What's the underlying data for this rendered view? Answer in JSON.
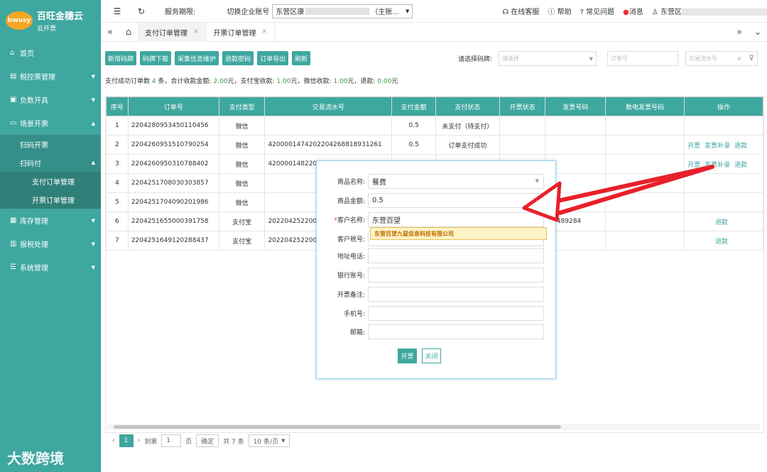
{
  "sidebar": {
    "logo_mark": "bwusy",
    "title": "百旺金穗云",
    "subtitle": "云开票",
    "items": [
      {
        "label": "首页",
        "icon": "home-icon"
      },
      {
        "label": "税控票管理",
        "icon": "ledger-icon"
      },
      {
        "label": "负数开具",
        "icon": "document-icon"
      },
      {
        "label": "场景开票",
        "icon": "card-icon"
      }
    ],
    "sub_items": [
      "扫码开票",
      "扫码付"
    ],
    "subsub_items": [
      "支付订单管理",
      "开票订单管理"
    ],
    "bottom_items": [
      {
        "label": "库存管理",
        "icon": "box-icon"
      },
      {
        "label": "报税处理",
        "icon": "chart-icon"
      },
      {
        "label": "系统管理",
        "icon": "settings-icon"
      }
    ],
    "watermark": "大数跨境"
  },
  "topbar": {
    "service_label": "服务期限:",
    "switch_label": "切换企业账号",
    "account_prefix": "东营区康",
    "account_suffix": "（主账...",
    "online": "在线客服",
    "help": "帮助",
    "faq": "常见问题",
    "messages": "消息",
    "user": "东营区"
  },
  "tabs": [
    {
      "label": "支付订单管理",
      "active": true
    },
    {
      "label": "开票订单管理",
      "active": false
    }
  ],
  "toolbar": {
    "buttons": [
      "新增码牌",
      "码牌下载",
      "采集信息维护",
      "退款密码",
      "订单导出",
      "刷新"
    ],
    "filter_label": "请选择码牌:",
    "select_placeholder": "请选择",
    "order_placeholder": "订单号",
    "serial_placeholder": "交易流水号"
  },
  "summary": {
    "p1": "支付成功订单数",
    "count": "4",
    "p2": "条，合计收款金额:",
    "total": "2.00",
    "p3": "元，支付宝收款:",
    "alipay": "1.00",
    "p4": "元，微信收款:",
    "wechat": "1.00",
    "p5": "元，退款:",
    "refund": "0.00",
    "p6": "元"
  },
  "table": {
    "headers": [
      "序号",
      "订单号",
      "支付类型",
      "交易流水号",
      "支付金额",
      "支付状态",
      "开票状态",
      "发票号码",
      "数电发票号码",
      "操作"
    ],
    "rows": [
      {
        "no": "1",
        "order": "2204280953450110456",
        "type": "微信",
        "serial": "",
        "amount": "0.5",
        "status": "未支付（待支付）",
        "invoice_status": "",
        "invoice_no": "",
        "digital_no": "",
        "ops": []
      },
      {
        "no": "2",
        "order": "2204260951510790254",
        "type": "微信",
        "serial": "4200001474202204268818931261",
        "amount": "0.5",
        "status": "订单支付成功",
        "invoice_status": "",
        "invoice_no": "",
        "digital_no": "",
        "ops": [
          "开票",
          "发票补录",
          "退款"
        ]
      },
      {
        "no": "3",
        "order": "2204260950310788402",
        "type": "微信",
        "serial": "4200001482202",
        "amount": "",
        "status": "",
        "invoice_status": "",
        "invoice_no": "",
        "digital_no": "",
        "ops": [
          "开票",
          "发票补录",
          "退款"
        ]
      },
      {
        "no": "4",
        "order": "2204251708030303857",
        "type": "微信",
        "serial": "",
        "amount": "",
        "status": "",
        "invoice_status": "",
        "invoice_no": "",
        "digital_no": "",
        "ops": []
      },
      {
        "no": "5",
        "order": "2204251704090201986",
        "type": "微信",
        "serial": "",
        "amount": "",
        "status": "",
        "invoice_status": "",
        "invoice_no": "",
        "digital_no": "",
        "ops": []
      },
      {
        "no": "6",
        "order": "2204251655000391758",
        "type": "支付宝",
        "serial": "2022042522003",
        "amount": "",
        "status": "",
        "invoice_status": "",
        "invoice_no": "83489284",
        "digital_no": "",
        "ops": [
          "退款"
        ]
      },
      {
        "no": "7",
        "order": "2204251649120288437",
        "type": "支付宝",
        "serial": "2022042522003",
        "amount": "",
        "status": "",
        "invoice_status": "",
        "invoice_no": "",
        "digital_no": "",
        "ops": [
          "退款"
        ]
      }
    ]
  },
  "pager": {
    "current": "1",
    "goto": "到第",
    "page_input": "1",
    "page_unit": "页",
    "confirm": "确定",
    "total": "共 7 条",
    "page_size": "10 条/页"
  },
  "modal": {
    "fields": [
      {
        "label": "商品名称:",
        "value": "餐费",
        "type": "select",
        "required": false
      },
      {
        "label": "商品金额:",
        "value": "0.5",
        "type": "text",
        "required": false
      },
      {
        "label": "客户名称:",
        "value": "东营百望",
        "type": "text",
        "required": true
      },
      {
        "label": "客户税号:",
        "value": "",
        "type": "text",
        "required": false
      },
      {
        "label": "地址电话:",
        "value": "",
        "type": "text",
        "required": false
      },
      {
        "label": "银行账号:",
        "value": "",
        "type": "text",
        "required": false
      },
      {
        "label": "开票备注:",
        "value": "",
        "type": "text",
        "required": false
      },
      {
        "label": "手机号:",
        "value": "",
        "type": "text",
        "required": false
      },
      {
        "label": "邮箱:",
        "value": "",
        "type": "text",
        "required": false
      }
    ],
    "suggestion": "东营百望九鼠信息科技有限公司",
    "submit": "开票",
    "close": "关闭"
  },
  "colors": {
    "primary": "#3ea79f",
    "annotation_arrow": "#e8202a"
  }
}
